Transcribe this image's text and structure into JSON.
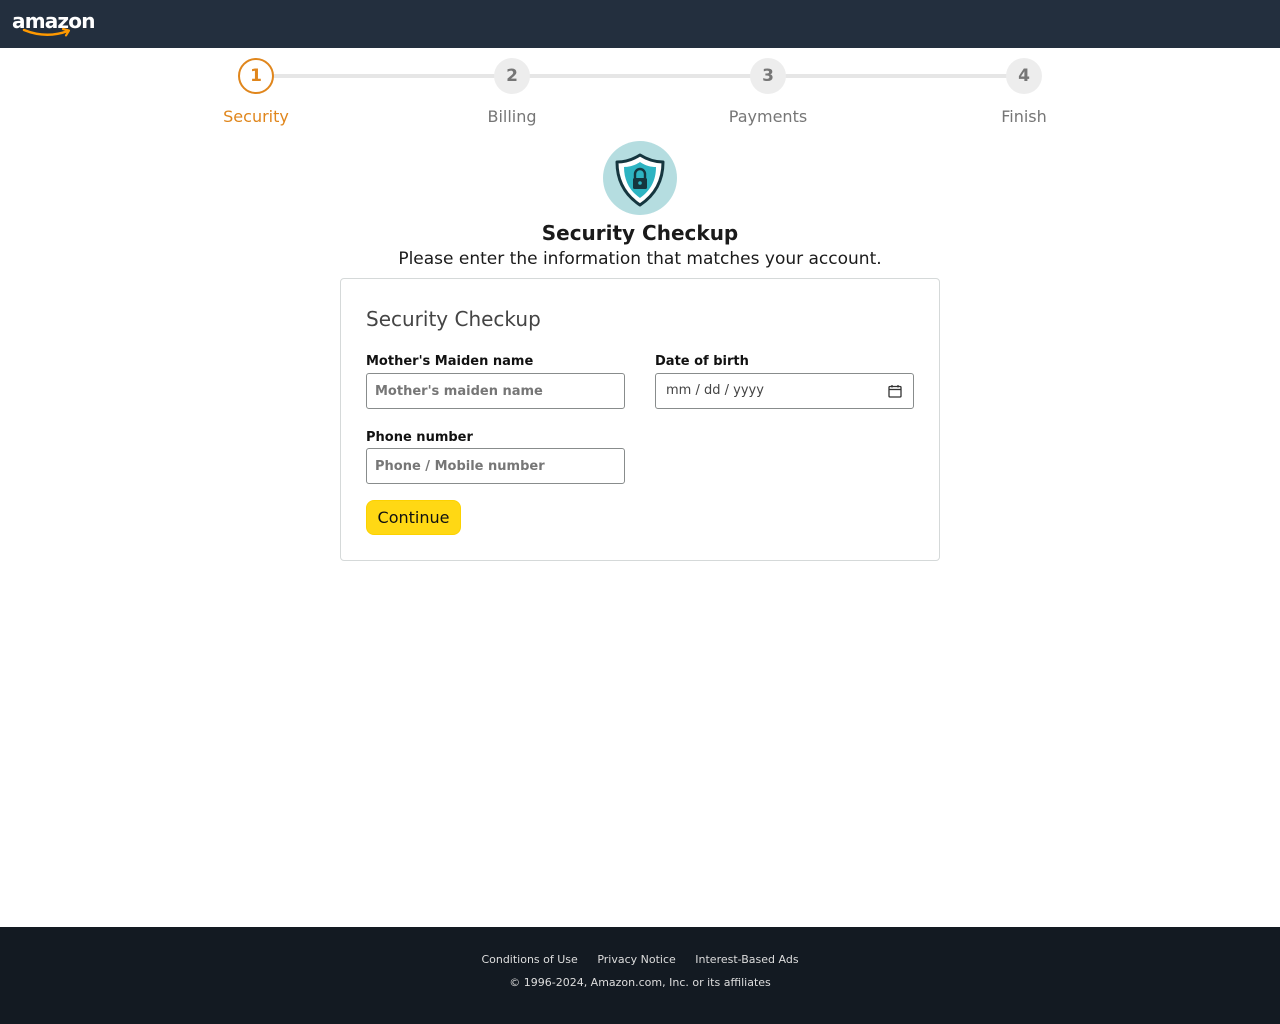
{
  "header": {
    "logo_text": "amazon"
  },
  "stepper": {
    "steps": [
      {
        "number": "1",
        "label": "Security",
        "active": true
      },
      {
        "number": "2",
        "label": "Billing",
        "active": false
      },
      {
        "number": "3",
        "label": "Payments",
        "active": false
      },
      {
        "number": "4",
        "label": "Finish",
        "active": false
      }
    ]
  },
  "hero": {
    "icon": "shield-lock-icon",
    "title": "Security Checkup",
    "subtitle": "Please enter the information that matches your account."
  },
  "form": {
    "title": "Security Checkup",
    "maiden_name": {
      "label": "Mother's Maiden name",
      "placeholder": "Mother's maiden name",
      "value": ""
    },
    "dob": {
      "label": "Date of birth",
      "placeholder": "mm / dd / yyyy",
      "icon": "calendar-icon"
    },
    "phone": {
      "label": "Phone number",
      "placeholder": "Phone / Mobile number",
      "value": ""
    },
    "continue_label": "Continue"
  },
  "footer": {
    "links": [
      "Conditions of Use",
      "Privacy Notice",
      "Interest-Based Ads"
    ],
    "copyright": "© 1996-2024, Amazon.com, Inc. or its affiliates"
  },
  "colors": {
    "topbar": "#232f3e",
    "accent": "#e0861c",
    "button": "#ffd814",
    "footer": "#131a22"
  }
}
